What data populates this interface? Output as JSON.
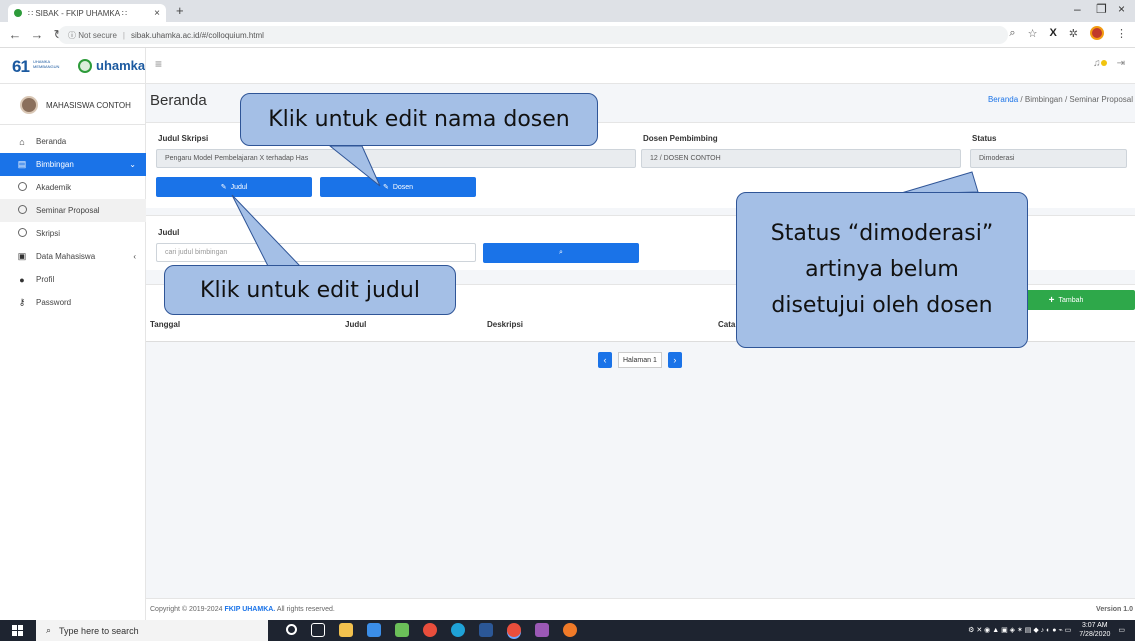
{
  "browser": {
    "tab_title": "∷ SIBAK - FKIP UHAMKA ∷",
    "url_security": "Not secure",
    "url": "sibak.uhamka.ac.id/#/colloquium.html"
  },
  "header": {
    "logo_number": "61",
    "logo_tagline": "UHAMKA MEMBANGUN",
    "brand": "uhamka"
  },
  "sidebar": {
    "user_name": "MAHASISWA CONTOH",
    "items": [
      {
        "label": "Beranda"
      },
      {
        "label": "Bimbingan"
      },
      {
        "label": "Akademik"
      },
      {
        "label": "Seminar Proposal"
      },
      {
        "label": "Skripsi"
      },
      {
        "label": "Data Mahasiswa"
      },
      {
        "label": "Profil"
      },
      {
        "label": "Password"
      }
    ]
  },
  "page": {
    "title": "Beranda",
    "breadcrumb": {
      "home": "Beranda",
      "sep": "/",
      "section": "Bimbingan",
      "current": "Seminar Proposal"
    }
  },
  "form": {
    "judul_label": "Judul Skripsi",
    "judul_value": "Pengaru Model Pembelajaran X terhadap Has",
    "dosen_label": "Dosen Pembimbing",
    "dosen_value": "12 / DOSEN CONTOH",
    "status_label": "Status",
    "status_value": "Dimoderasi",
    "btn_judul": "Judul",
    "btn_dosen": "Dosen"
  },
  "search": {
    "label": "Judul",
    "placeholder": "cari judul bimbingan"
  },
  "table": {
    "add_label": "Tambah",
    "headers": [
      "Tanggal",
      "Judul",
      "Deskripsi",
      "Cata"
    ]
  },
  "pager": {
    "label": "Halaman 1"
  },
  "footer": {
    "copyright": "Copyright © 2019-2024",
    "org": "FKIP UHAMKA.",
    "rights": "All rights reserved.",
    "version": "Version 1.0"
  },
  "callouts": {
    "dosen": "Klik untuk edit nama dosen",
    "judul": "Klik untuk edit judul",
    "status": "Status “dimoderasi” artinya belum disetujui oleh dosen"
  },
  "taskbar": {
    "search_placeholder": "Type here to search",
    "time": "3:07 AM",
    "date": "7/28/2020"
  }
}
